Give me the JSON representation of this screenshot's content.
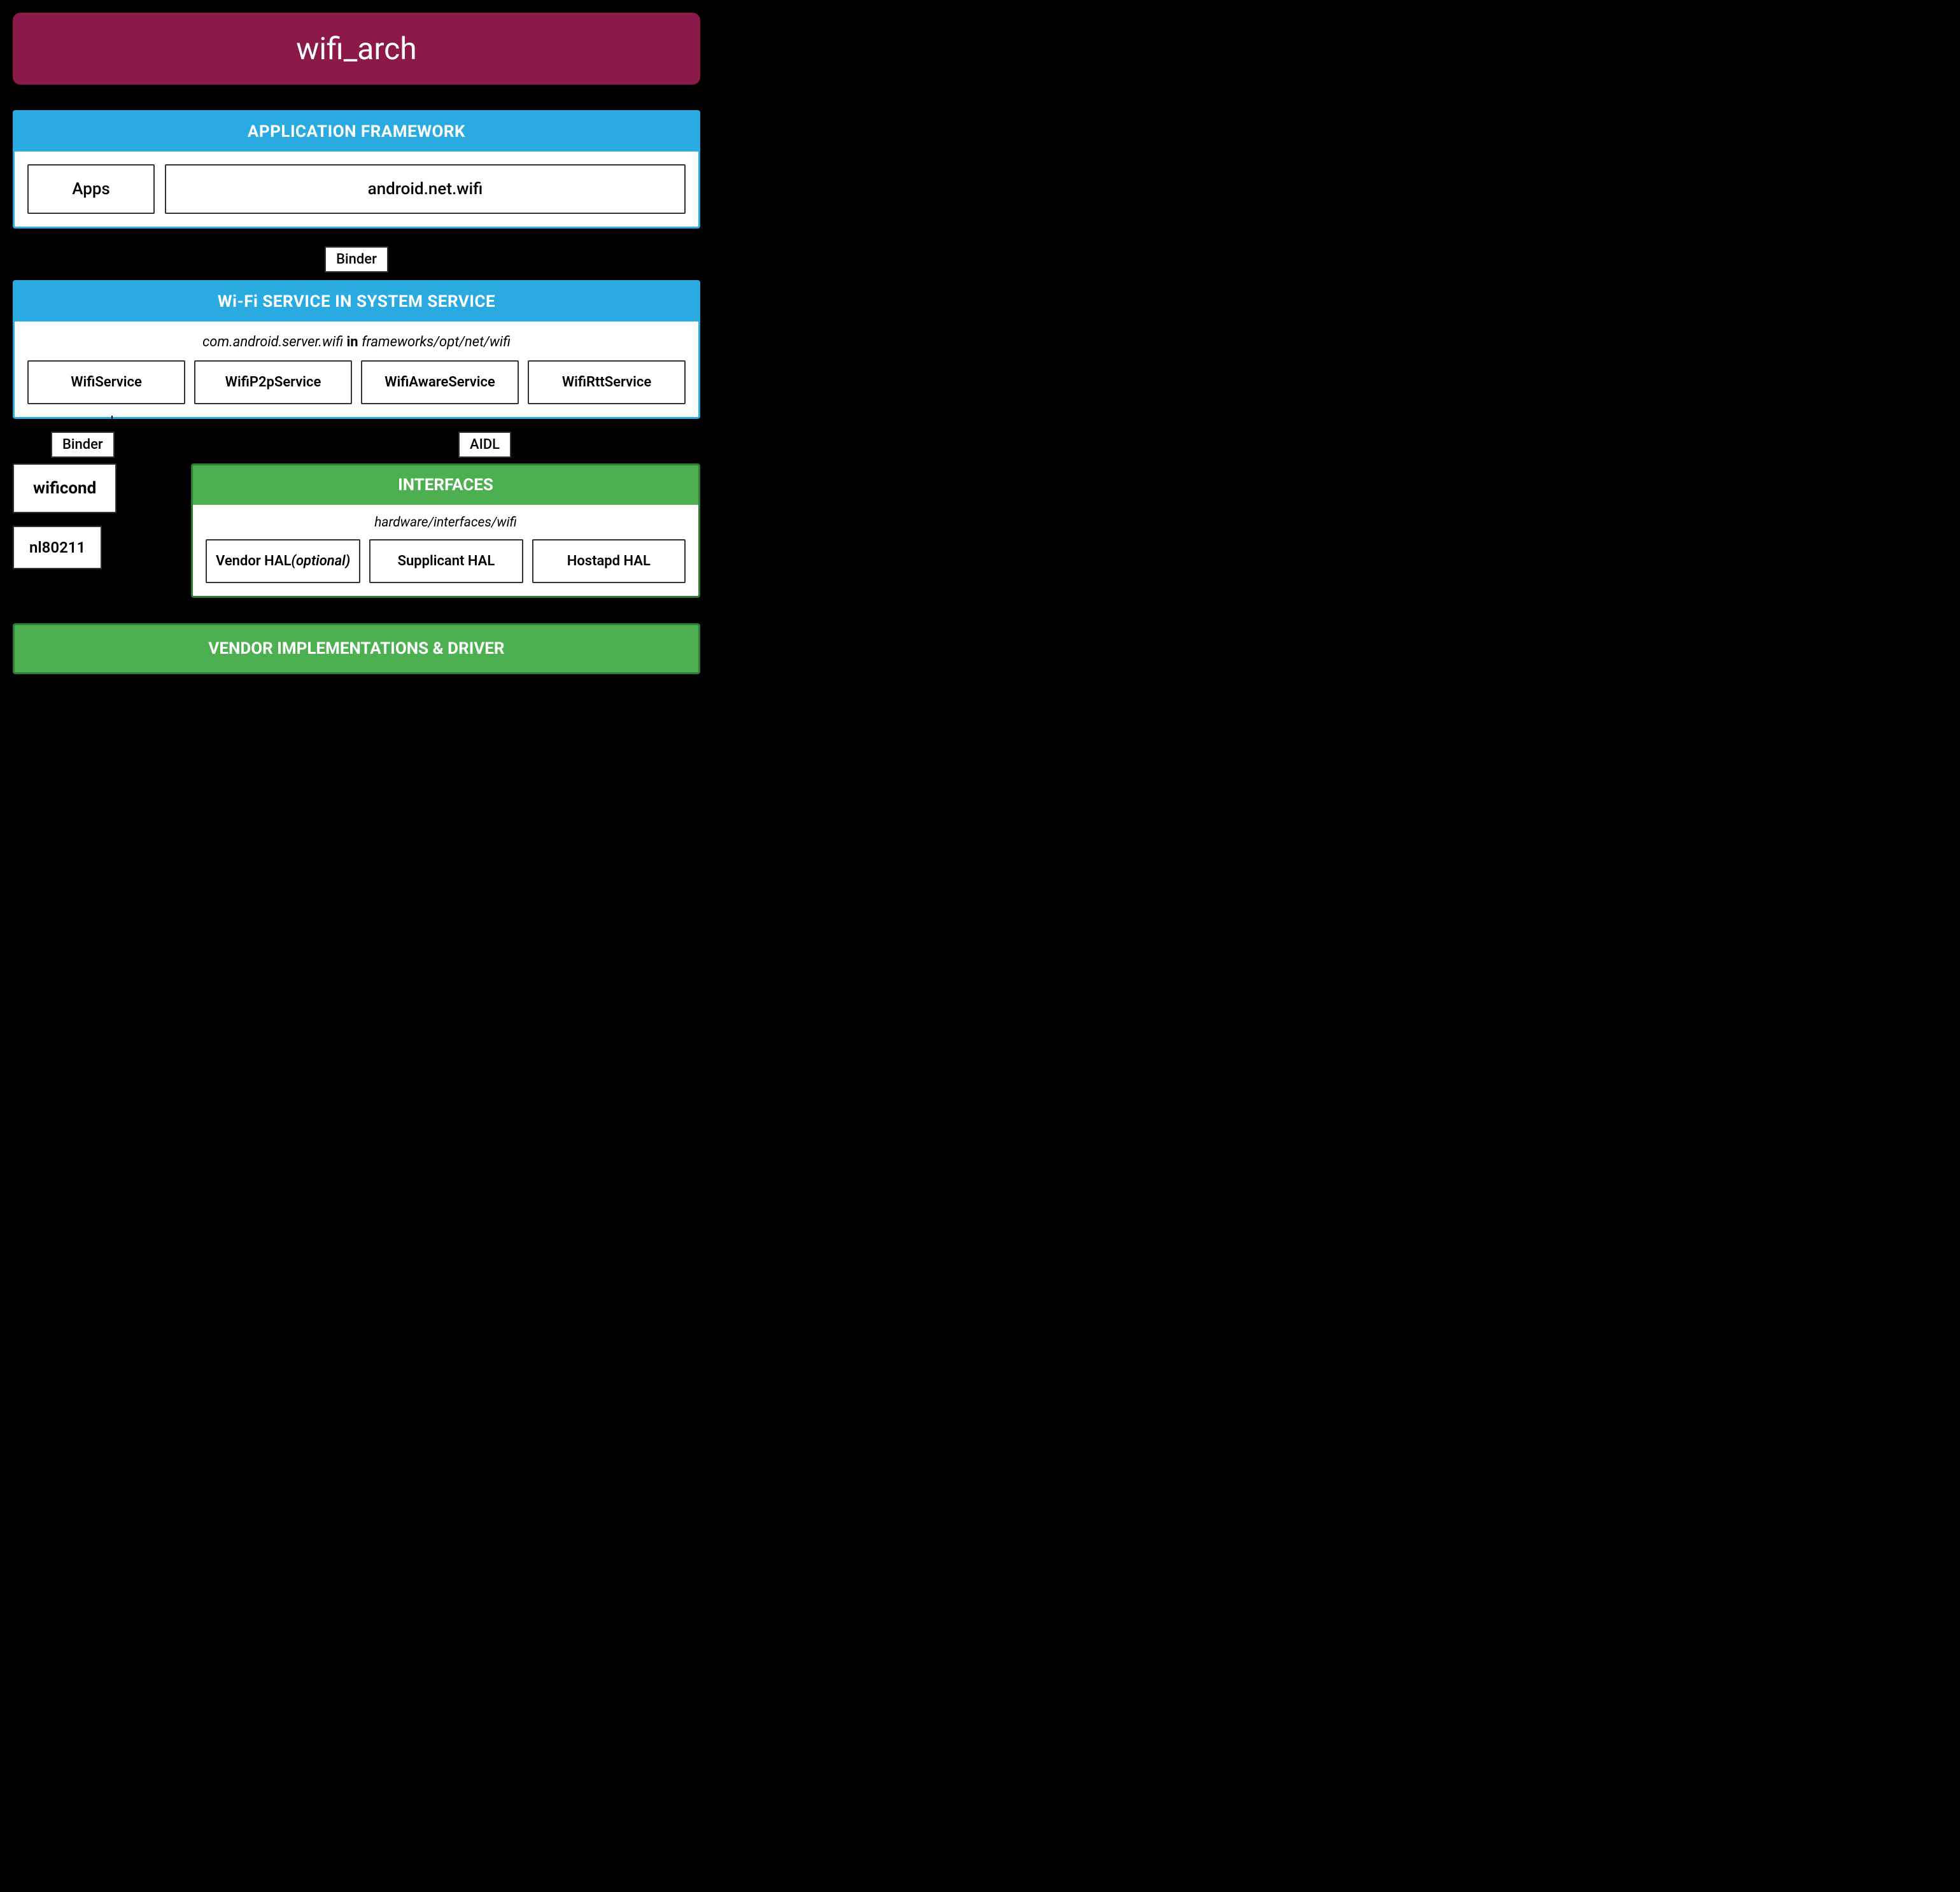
{
  "title": "wifi_arch",
  "colors": {
    "title_bg": "#8B1A4A",
    "blue": "#29ABE2",
    "green": "#4CAF50",
    "black": "#000000",
    "white": "#ffffff"
  },
  "app_framework": {
    "header": "APPLICATION FRAMEWORK",
    "apps_label": "Apps",
    "android_net_wifi_label": "android.net.wifi"
  },
  "binder_label": "Binder",
  "wifi_service": {
    "header": "Wi-Fi SERVICE IN SYSTEM SERVICE",
    "subtitle_italic": "com.android.server.wifi",
    "subtitle_bold": "in",
    "subtitle_rest": "frameworks/opt/net/wifi",
    "services": [
      "WifiService",
      "WifiP2pService",
      "WifiAwareService",
      "WifiRttService"
    ]
  },
  "binder_left_label": "Binder",
  "aidl_label": "AIDL",
  "wificond_label": "wificond",
  "nl80211_label": "nl80211",
  "interfaces": {
    "header": "INTERFACES",
    "subtitle": "hardware/interfaces/wifi",
    "items": [
      "Vendor HAL (optional)",
      "Supplicant HAL",
      "Hostapd HAL"
    ]
  },
  "vendor": {
    "header": "VENDOR IMPLEMENTATIONS & DRIVER"
  }
}
